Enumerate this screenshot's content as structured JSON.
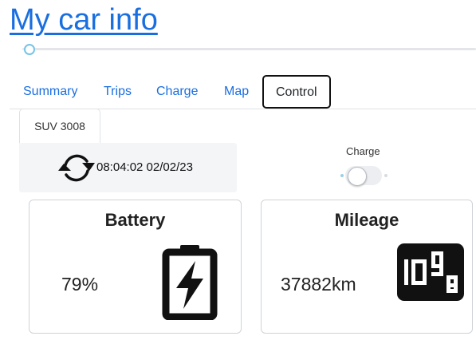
{
  "app": {
    "title": "My car info"
  },
  "tabs": [
    {
      "label": "Summary",
      "active": false
    },
    {
      "label": "Trips",
      "active": false
    },
    {
      "label": "Charge",
      "active": false
    },
    {
      "label": "Map",
      "active": false
    },
    {
      "label": "Control",
      "active": true
    }
  ],
  "vehicle_tab": {
    "label": "SUV 3008"
  },
  "refresh": {
    "icon": "refresh-icon",
    "timestamp": "08:04:02 02/02/23"
  },
  "charge_toggle": {
    "label": "Charge",
    "on": false
  },
  "battery_card": {
    "title": "Battery",
    "value": "79%",
    "icon": "battery-charging-icon"
  },
  "mileage_card": {
    "title": "Mileage",
    "value": "37882km",
    "icon": "odometer-icon"
  },
  "colors": {
    "link": "#1a6fe0",
    "slider_accent": "#77c4e6",
    "panel_bg": "#f4f5f7"
  }
}
